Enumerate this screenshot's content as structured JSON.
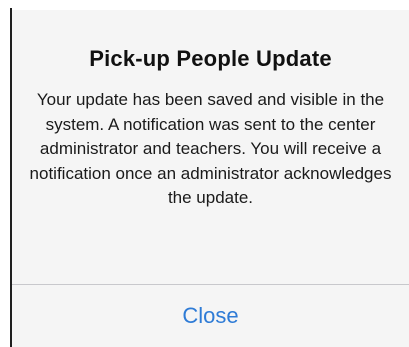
{
  "alert": {
    "title": "Pick-up People Update",
    "message": "Your update has been saved and visible in the system. A notification was sent to the center administrator and teachers. You will receive a notification once an administrator acknowledges the update.",
    "close_label": "Close"
  },
  "colors": {
    "dialog_background": "#f5f5f5",
    "title_text": "#111111",
    "message_text": "#1a1a1a",
    "action_link": "#2e7bd6",
    "divider": "#c8c8cc"
  }
}
